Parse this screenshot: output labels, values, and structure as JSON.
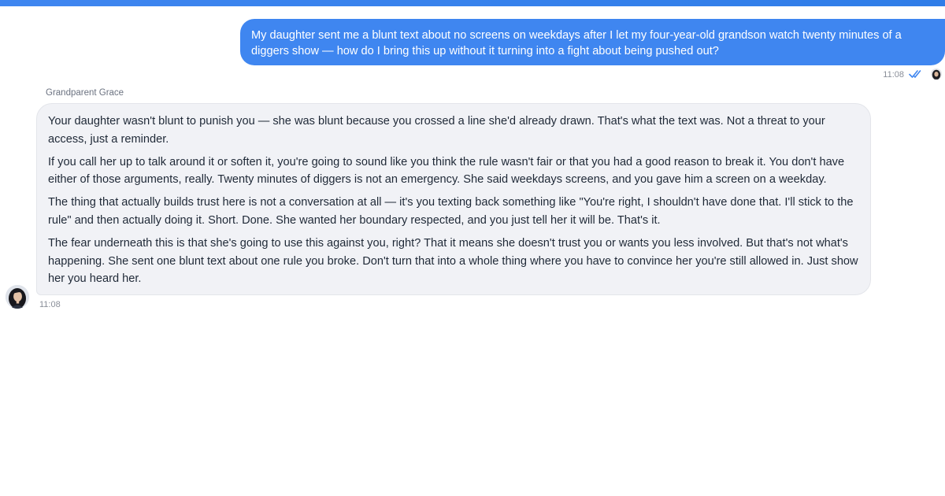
{
  "user_message": {
    "text": "My daughter sent me a blunt text about no screens on weekdays after I let my four-year-old grandson watch twenty minutes of a diggers show — how do I bring this up without it turning into a fight about being pushed out?",
    "time": "11:08",
    "status_icon": "double-check-icon",
    "accent_color": "#3f86f0"
  },
  "assistant_message": {
    "sender": "Grandparent Grace",
    "time": "11:08",
    "paragraphs": [
      "Your daughter wasn't blunt to punish you — she was blunt because you crossed a line she'd already drawn. That's what the text was. Not a threat to your access, just a reminder.",
      "If you call her up to talk around it or soften it, you're going to sound like you think the rule wasn't fair or that you had a good reason to break it. You don't have either of those arguments, really. Twenty minutes of diggers is not an emergency. She said weekdays screens, and you gave him a screen on a weekday.",
      "The thing that actually builds trust here is not a conversation at all — it's you texting back something like \"You're right, I shouldn't have done that. I'll stick to the rule\" and then actually doing it. Short. Done. She wanted her boundary respected, and you just tell her it will be. That's it.",
      "The fear underneath this is that she's going to use this against you, right? That it means she doesn't trust you or wants you less involved. But that's not what's happening. She sent one blunt text about one rule you broke. Don't turn that into a whole thing where you have to convince her you're still allowed in. Just show her you heard her."
    ]
  }
}
